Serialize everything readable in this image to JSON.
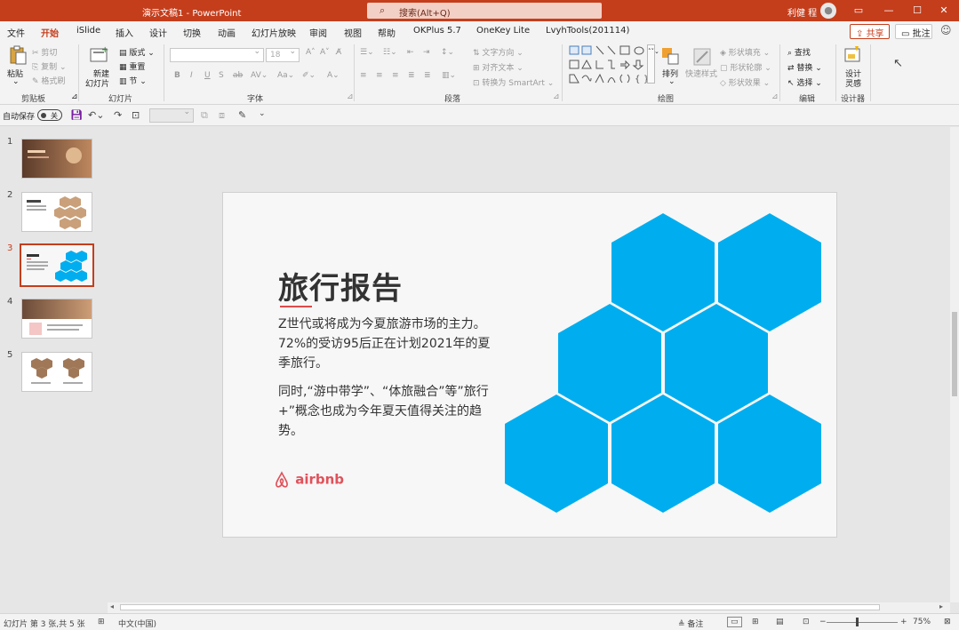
{
  "window": {
    "title": "演示文稿1  -  PowerPoint",
    "search_placeholder": "搜索(Alt+Q)",
    "user": "利健 程"
  },
  "menu": {
    "file": "文件",
    "tabs": [
      "开始",
      "iSlide",
      "插入",
      "设计",
      "切换",
      "动画",
      "幻灯片放映",
      "审阅",
      "视图",
      "帮助",
      "OKPlus 5.7",
      "OneKey Lite",
      "LvyhTools(201114)"
    ],
    "share": "共享",
    "comment": "批注"
  },
  "ribbon": {
    "clipboard": {
      "paste": "粘贴",
      "cut": "剪切",
      "copy": "复制",
      "format_painter": "格式刷",
      "label": "剪贴板"
    },
    "slides": {
      "new_slide_line1": "新建",
      "new_slide_line2": "幻灯片",
      "layout": "版式",
      "reset": "重置",
      "section": "节",
      "label": "幻灯片"
    },
    "font": {
      "label": "字体",
      "bold": "B",
      "italic": "I",
      "underline": "U",
      "strike": "S",
      "font_size": "18"
    },
    "paragraph": {
      "text_direction": "文字方向",
      "align_text": "对齐文本",
      "smartart": "转换为 SmartArt",
      "label": "段落"
    },
    "drawing": {
      "arrange": "排列",
      "quick_styles": "快速样式",
      "shape_fill": "形状填充",
      "shape_outline": "形状轮廓",
      "shape_effects": "形状效果",
      "label": "绘图"
    },
    "editing": {
      "find": "查找",
      "replace": "替换",
      "select": "选择",
      "label": "编辑"
    },
    "designer": {
      "line1": "设计",
      "line2": "灵感",
      "label": "设计器"
    }
  },
  "qat": {
    "autosave": "自动保存",
    "toggle": "关"
  },
  "thumbnails": [
    "1",
    "2",
    "3",
    "4",
    "5"
  ],
  "slide": {
    "title": "旅行报告",
    "para1": "Z世代或将成为今夏旅游市场的主力。72%的受访95后正在计划2021年的夏季旅行。",
    "para2": "同时,“游中带学”、“体旅融合”等”旅行+”概念也成为今年夏天值得关注的趋势。",
    "logo_text": "airbnb"
  },
  "status": {
    "slide_info": "幻灯片 第 3 张,共 5 张",
    "language": "中文(中国)",
    "notes": "备注",
    "zoom": "75%"
  },
  "colors": {
    "accent": "#c43e1c",
    "hexagon": "#00aeef",
    "rule": "#e04a4a",
    "logo": "#e0525a"
  }
}
